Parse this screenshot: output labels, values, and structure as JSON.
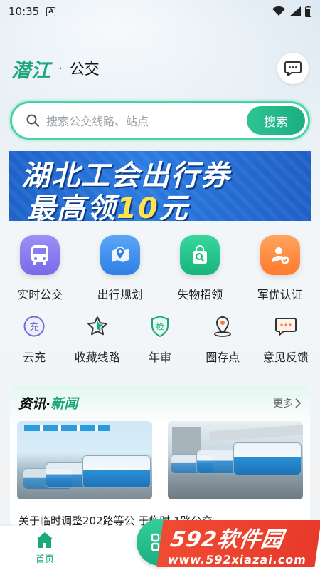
{
  "status_bar": {
    "time": "10:35",
    "sim": "A"
  },
  "header": {
    "brand": "潜江",
    "dot": "·",
    "subtitle": "公交"
  },
  "search": {
    "placeholder": "搜索公交线路、站点",
    "button": "搜索"
  },
  "banner": {
    "line1": "湖北工会出行券",
    "line2_text": "最高领",
    "line2_num": "10",
    "line2_unit": "元"
  },
  "main_grid": [
    {
      "label": "实时公交",
      "icon": "bus-icon",
      "color": "#8a7cf0"
    },
    {
      "label": "出行规划",
      "icon": "map-pin-icon",
      "color": "#3d8ff0"
    },
    {
      "label": "失物招领",
      "icon": "search-bag-icon",
      "color": "#22c48a"
    },
    {
      "label": "军优认证",
      "icon": "user-check-icon",
      "color": "#ff8a3d"
    }
  ],
  "sub_grid": [
    {
      "label": "云充",
      "icon": "recharge-icon",
      "glyph": "充"
    },
    {
      "label": "收藏线路",
      "icon": "star-icon"
    },
    {
      "label": "年审",
      "icon": "shield-icon",
      "glyph": "检"
    },
    {
      "label": "圈存点",
      "icon": "location-icon"
    },
    {
      "label": "意见反馈",
      "icon": "feedback-icon"
    }
  ],
  "news": {
    "title_a": "资讯",
    "dot": "·",
    "title_b": "新闻",
    "more": "更多",
    "headline": "关于临时调整202路等公  于临时    1路公交"
  },
  "tabbar": {
    "home": "首页"
  },
  "watermark": {
    "brand": "592软件园",
    "url": "www.592xiazai.com"
  }
}
